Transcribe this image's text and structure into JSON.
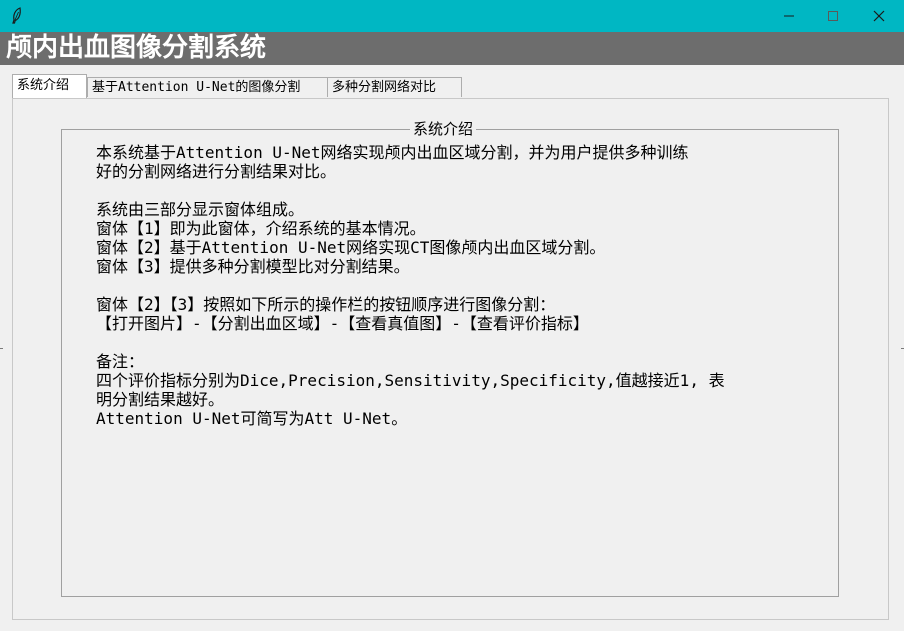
{
  "window": {
    "app_icon": "feather-icon",
    "controls": [
      "minimize-icon",
      "maximize-icon",
      "close-icon"
    ],
    "titlebar_color": "#00b7c3"
  },
  "header": {
    "title": "颅内出血图像分割系统",
    "background": "#6d6d6d"
  },
  "tabs": [
    {
      "label": "系统介绍",
      "active": true
    },
    {
      "label": "基于Attention U-Net的图像分割",
      "active": false
    },
    {
      "label": "多种分割网络对比",
      "active": false
    }
  ],
  "intro": {
    "group_title": "系统介绍",
    "lines": [
      "本系统基于Attention U-Net网络实现颅内出血区域分割，并为用户提供多种训练",
      "好的分割网络进行分割结果对比。",
      "",
      "系统由三部分显示窗体组成。",
      "窗体【1】即为此窗体，介绍系统的基本情况。",
      "窗体【2】基于Attention U-Net网络实现CT图像颅内出血区域分割。",
      "窗体【3】提供多种分割模型比对分割结果。",
      "",
      "窗体【2】【3】按照如下所示的操作栏的按钮顺序进行图像分割：",
      "【打开图片】-【分割出血区域】-【查看真值图】-【查看评价指标】",
      "",
      "备注：",
      "四个评价指标分别为Dice,Precision,Sensitivity,Specificity,值越接近1, 表",
      "明分割结果越好。",
      "Attention U-Net可简写为Att U-Net。"
    ]
  }
}
